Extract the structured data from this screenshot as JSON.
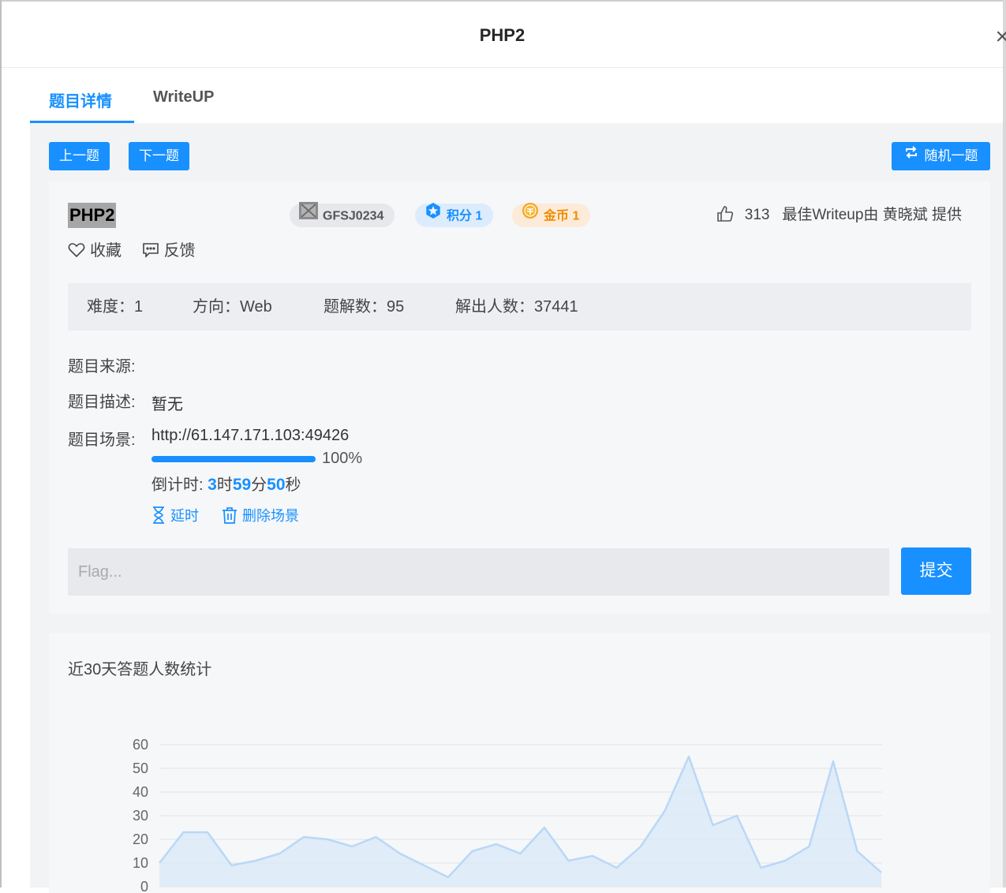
{
  "modal": {
    "title": "PHP2",
    "close_glyph": "×"
  },
  "tabs": [
    {
      "label": "题目详情",
      "active": true
    },
    {
      "label": "WriteUP",
      "active": false
    }
  ],
  "nav": {
    "prev": "上一题",
    "next": "下一题",
    "random": "随机一题"
  },
  "question": {
    "title": "PHP2",
    "id": "GFSJ0234",
    "score_label": "积分 1",
    "coin_label": "金币 1",
    "likes": "313",
    "writeup_credit": "最佳Writeup由 黄晓斌 提供",
    "favorite": "收藏",
    "feedback": "反馈"
  },
  "stats": {
    "difficulty": "难度：1",
    "direction": "方向：Web",
    "solves": "题解数：95",
    "solvers": "解出人数：37441"
  },
  "details": {
    "source_label": "题目来源:",
    "source_value": "",
    "desc_label": "题目描述:",
    "desc_value": "暂无",
    "scene_label": "题目场景:",
    "scene_url": "http://61.147.171.103:49426",
    "progress": 1.0,
    "progress_text": "100%",
    "countdown_label": "倒计时: ",
    "hours": "3",
    "hours_unit": "时",
    "minutes": "59",
    "minutes_unit": "分",
    "seconds": "50",
    "seconds_unit": "秒",
    "extend": "延时",
    "delete_scene": "删除场景"
  },
  "flag": {
    "placeholder": "Flag...",
    "submit": "提交"
  },
  "colors": {
    "accent": "#1890ff",
    "coin": "#f08c00",
    "chart_line": "#b9d8f7",
    "chart_fill": "#dbe9f8"
  },
  "chart_data": {
    "type": "area",
    "title": "近30天答题人数统计",
    "y_ticks": [
      0,
      10,
      20,
      30,
      40,
      50,
      60
    ],
    "ylim": [
      0,
      60
    ],
    "grid": true,
    "values": [
      10,
      23,
      23,
      9,
      11,
      14,
      21,
      20,
      17,
      21,
      14,
      9,
      4,
      15,
      18,
      14,
      25,
      11,
      13,
      8,
      17,
      32,
      55,
      26,
      30,
      8,
      11,
      17,
      53,
      15,
      6
    ]
  }
}
